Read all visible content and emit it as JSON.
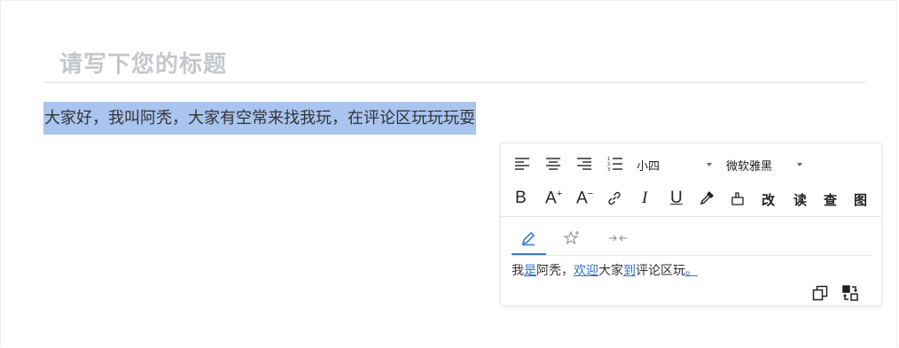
{
  "editor": {
    "title_placeholder": "请写下您的标题",
    "body_text": "大家好，我叫阿秃，大家有空常来找我玩，在评论区玩玩玩耍"
  },
  "toolbar": {
    "font_size": "小四",
    "font_family": "微软雅黑",
    "bold_label": "B",
    "increase_font_label": "A",
    "decrease_font_label": "A",
    "italic_label": "I",
    "underline_label": "U",
    "correct_label": "改",
    "read_label": "读",
    "check_label": "查",
    "image_label": "图"
  },
  "suggestion": {
    "parts": [
      {
        "text": "我",
        "hl": false
      },
      {
        "text": "是",
        "hl": true
      },
      {
        "text": "阿秃，",
        "hl": false
      },
      {
        "text": "欢迎",
        "hl": true
      },
      {
        "text": "大家",
        "hl": false
      },
      {
        "text": "到",
        "hl": true
      },
      {
        "text": "评论区玩",
        "hl": false
      },
      {
        "text": "。",
        "hl": true
      }
    ]
  },
  "colors": {
    "selection": "#a9c4ef",
    "accent": "#3a7bd5",
    "title_placeholder": "#c4c7cc"
  }
}
